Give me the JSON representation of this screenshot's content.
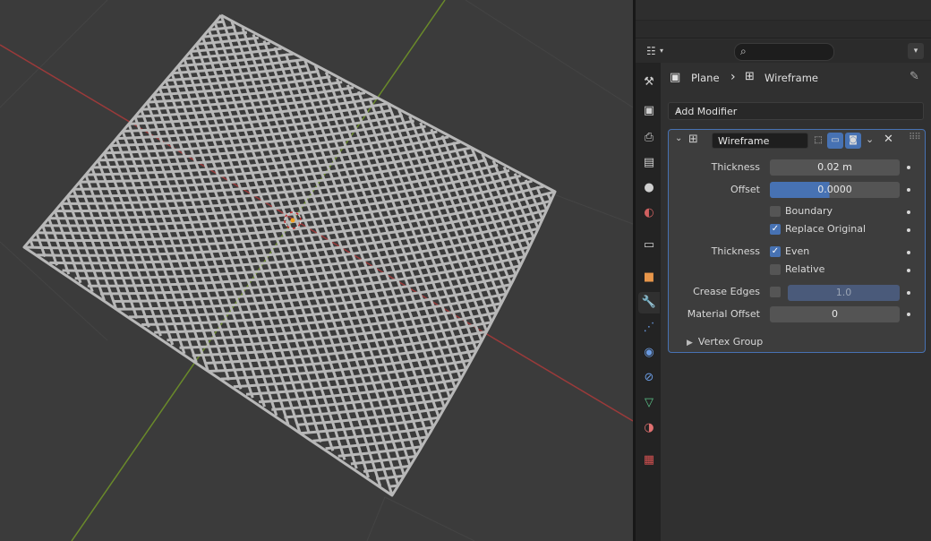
{
  "viewport": {
    "object_name": "Plane"
  },
  "properties": {
    "header": {
      "editor_icon": "properties-editor-icon",
      "search_placeholder": ""
    },
    "tabs": [
      {
        "name": "tool-icon",
        "glyph": "⚒",
        "color": "#cfcfcf"
      },
      {
        "name": "render-icon",
        "glyph": "▣",
        "color": "#cfcfcf"
      },
      {
        "name": "output-icon",
        "glyph": "⎙",
        "color": "#cfcfcf"
      },
      {
        "name": "view-layer-icon",
        "glyph": "▤",
        "color": "#cfcfcf"
      },
      {
        "name": "scene-icon",
        "glyph": "●",
        "color": "#cfcfcf"
      },
      {
        "name": "world-icon",
        "glyph": "◐",
        "color": "#d06060"
      },
      {
        "name": "collection-icon",
        "glyph": "▭",
        "color": "#cfcfcf"
      },
      {
        "name": "object-icon",
        "glyph": "■",
        "color": "#e8964a"
      },
      {
        "name": "modifier-icon",
        "glyph": "🔧",
        "color": "#6a9ae0",
        "active": true
      },
      {
        "name": "particles-icon",
        "glyph": "⋰",
        "color": "#6a9ae0"
      },
      {
        "name": "physics-icon",
        "glyph": "◉",
        "color": "#6a9ae0"
      },
      {
        "name": "constraints-icon",
        "glyph": "⊘",
        "color": "#6a9ae0"
      },
      {
        "name": "data-icon",
        "glyph": "▽",
        "color": "#5dc48a"
      },
      {
        "name": "material-icon",
        "glyph": "◑",
        "color": "#e07070"
      },
      {
        "name": "texture-icon",
        "glyph": "▦",
        "color": "#d25050"
      }
    ],
    "breadcrumb": {
      "object": "Plane",
      "separator": "›",
      "modifier": "Wireframe"
    },
    "add_modifier": "Add Modifier",
    "modifier": {
      "name": "Wireframe",
      "thickness_label": "Thickness",
      "thickness_value": "0.02 m",
      "offset_label": "Offset",
      "offset_value": "0.0000",
      "boundary_label": "Boundary",
      "boundary_checked": false,
      "replace_original_label": "Replace Original",
      "replace_original_checked": true,
      "thickness_group_label": "Thickness",
      "even_label": "Even",
      "even_checked": true,
      "relative_label": "Relative",
      "relative_checked": false,
      "crease_edges_label": "Crease Edges",
      "crease_edges_checked": false,
      "crease_weight_value": "1.0",
      "material_offset_label": "Material Offset",
      "material_offset_value": "0",
      "vertex_group_label": "Vertex Group"
    }
  },
  "colors": {
    "accent": "#4772b3",
    "x_axis": "#9b3a3a",
    "y_axis": "#6a8a2a"
  }
}
